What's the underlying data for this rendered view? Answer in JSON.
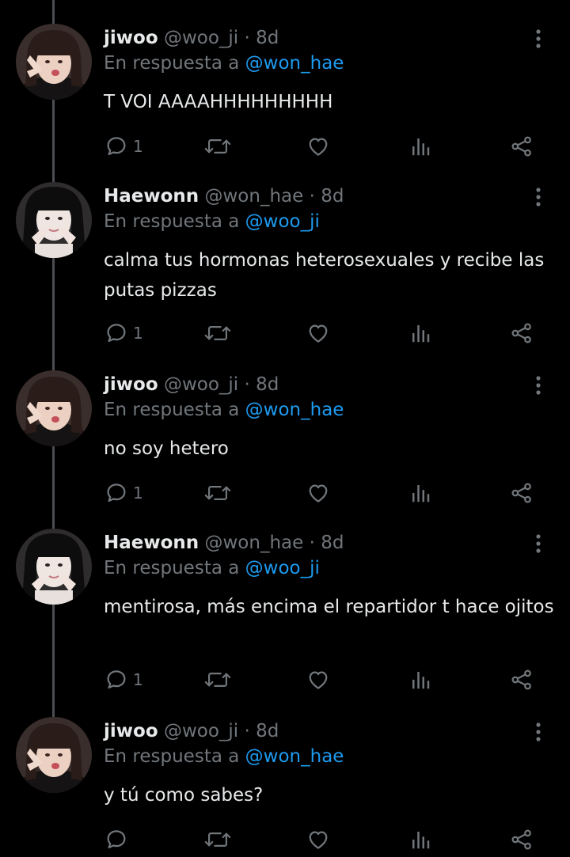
{
  "colors": {
    "background": "#000000",
    "text_primary": "#e7e9ea",
    "text_secondary": "#71767b",
    "mention": "#1d9bf0",
    "thread_line": "#4a4d52"
  },
  "icons": {
    "reply": "speech-bubble-icon",
    "retweet": "retweet-arrows-icon",
    "like": "heart-outline-icon",
    "views": "bar-chart-icon",
    "share": "share-nodes-icon",
    "more": "vertical-dots-icon"
  },
  "tweets": [
    {
      "name": "jiwoo",
      "handle": "@woo_ji",
      "separator": "·",
      "time": "8d",
      "reply_prefix": "En respuesta a",
      "reply_to": "@won_hae",
      "text": "T VOI AAAAHHHHHHHHH",
      "reply_count": "1"
    },
    {
      "name": "Haewonn",
      "handle": "@won_hae",
      "separator": "·",
      "time": "8d",
      "reply_prefix": "En respuesta a",
      "reply_to": "@woo_ji",
      "text": "calma tus hormonas heterosexuales y recibe las putas pizzas",
      "reply_count": "1"
    },
    {
      "name": "jiwoo",
      "handle": "@woo_ji",
      "separator": "·",
      "time": "8d",
      "reply_prefix": "En respuesta a",
      "reply_to": "@won_hae",
      "text": "no soy hetero",
      "reply_count": "1"
    },
    {
      "name": "Haewonn",
      "handle": "@won_hae",
      "separator": "·",
      "time": "8d",
      "reply_prefix": "En respuesta a",
      "reply_to": "@woo_ji",
      "text": "mentirosa, más encima el repartidor t hace ojitos",
      "reply_count": "1"
    },
    {
      "name": "jiwoo",
      "handle": "@woo_ji",
      "separator": "·",
      "time": "8d",
      "reply_prefix": "En respuesta a",
      "reply_to": "@won_hae",
      "text": "y tú como sabes?",
      "reply_count": ""
    }
  ]
}
